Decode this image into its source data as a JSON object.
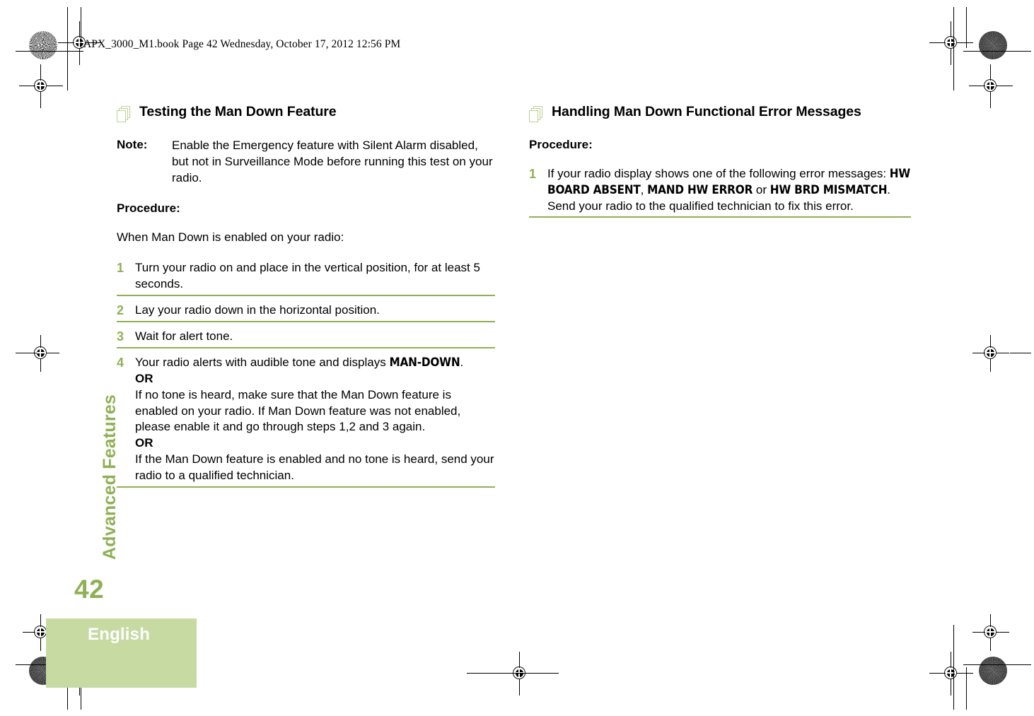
{
  "header": {
    "book_line": "APX_3000_M1.book  Page 42  Wednesday, October 17, 2012  12:56 PM"
  },
  "sidebar": {
    "chapter_label": "Advanced Features",
    "page_number": "42",
    "language_tab": "English"
  },
  "colors": {
    "accent_green": "#8FB055",
    "pale_green": "#C6DAA2",
    "icon_green": "#BBD28E",
    "text": "#000000"
  },
  "left_column": {
    "icon": "stacked-pages-icon",
    "section_title": "Testing the Man Down Feature",
    "note_label": "Note:",
    "note_text": "Enable the Emergency feature with Silent Alarm disabled, but not in Surveillance Mode before running this test on your radio.",
    "procedure_label": "Procedure:",
    "lead_paragraph": "When Man Down is enabled on your radio:",
    "steps": [
      {
        "number": "1",
        "text": "Turn your radio on and place in the vertical position, for at least 5 seconds."
      },
      {
        "number": "2",
        "text": "Lay your radio down in the horizontal position."
      },
      {
        "number": "3",
        "text": "Wait for alert tone."
      },
      {
        "number": "4",
        "text_part_1": "Your radio alerts with audible tone and displays ",
        "display_message": "MAN-DOWN",
        "text_part_2": ".",
        "or_1": "OR",
        "text_part_3": "If no tone is heard, make sure that the Man Down feature is enabled on your radio. If Man Down feature was not enabled, please enable it and go through steps 1,2 and 3 again.",
        "or_2": "OR",
        "text_part_4": "If the Man Down feature is enabled and no tone is heard, send your radio to a qualified technician."
      }
    ]
  },
  "right_column": {
    "icon": "stacked-pages-icon",
    "section_title": "Handling Man Down Functional Error Messages",
    "procedure_label": "Procedure:",
    "steps": [
      {
        "number": "1",
        "text_part_1": "If your radio display shows one of the following error messages: ",
        "error_1": "HW BOARD ABSENT",
        "sep_1": ", ",
        "error_2": "MAND HW ERROR",
        "sep_2": " or ",
        "error_3": "HW BRD MISMATCH",
        "text_part_2": ". Send your radio to the qualified technician to fix this error."
      }
    ]
  }
}
